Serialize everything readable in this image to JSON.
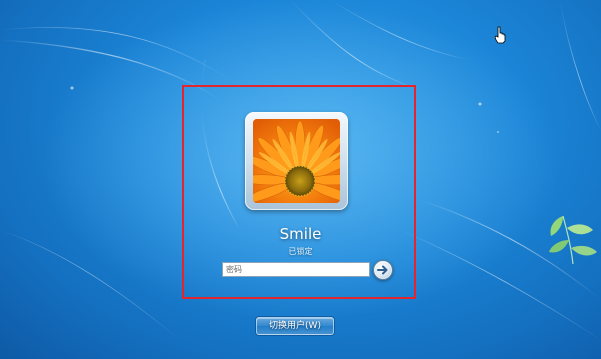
{
  "lock_screen": {
    "username": "Smile",
    "status": "已锁定",
    "password_placeholder": "密码",
    "submit_icon": "arrow-right-icon",
    "switch_user_label": "切换用户(W)"
  },
  "avatar": {
    "image": "orange-flower-photo"
  },
  "colors": {
    "background": "#1c86d8",
    "highlight_border": "#e3262d",
    "text": "#ffffff"
  }
}
